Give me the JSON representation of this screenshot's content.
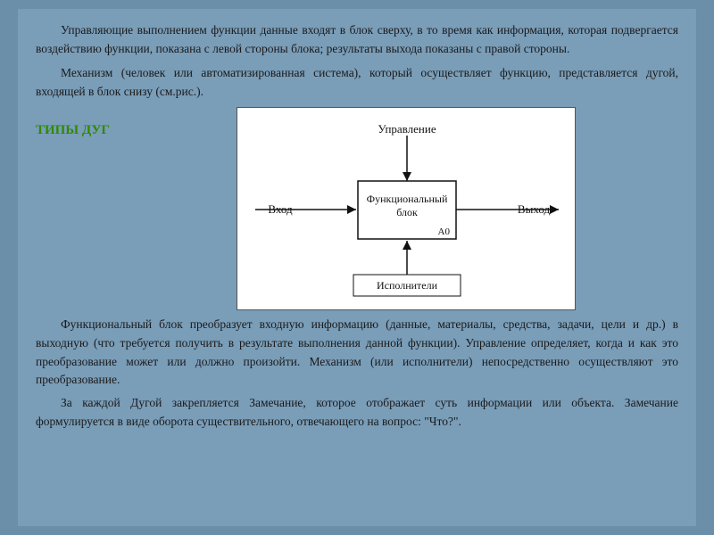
{
  "paragraphs": {
    "p1": "Управляющие выполнением функции данные входят в блок сверху, в то время как информация, которая подвергается воздействию функции, показана с левой стороны блока; результаты выхода показаны с правой стороны.",
    "p2": "Механизм (человек или автоматизированная система), который осуществляет функцию, представляется дугой, входящей в блок снизу (см.рис.).",
    "section_label": "ТИПЫ ДУГ",
    "diagram": {
      "control_label": "Управление",
      "function_label_line1": "Функциональный",
      "function_label_line2": "блок",
      "code_label": "A0",
      "input_label": "Вход",
      "output_label": "Выход",
      "mechanism_label": "Исполнители"
    },
    "p3": "Функциональный блок преобразует входную информацию (данные, материалы, средства, задачи, цели и др.) в выходную (что требуется получить в результате выполнения данной функции). Управление определяет, когда и как это преобразование может или должно произойти. Механизм (или исполнители) непосредственно осуществляют это преобразование.",
    "p4": "За каждой Дугой закрепляется Замечание, которое отображает суть информации или объекта. Замечание формулируется в виде оборота существительного, отвечающего на вопрос: \"Что?\"."
  }
}
